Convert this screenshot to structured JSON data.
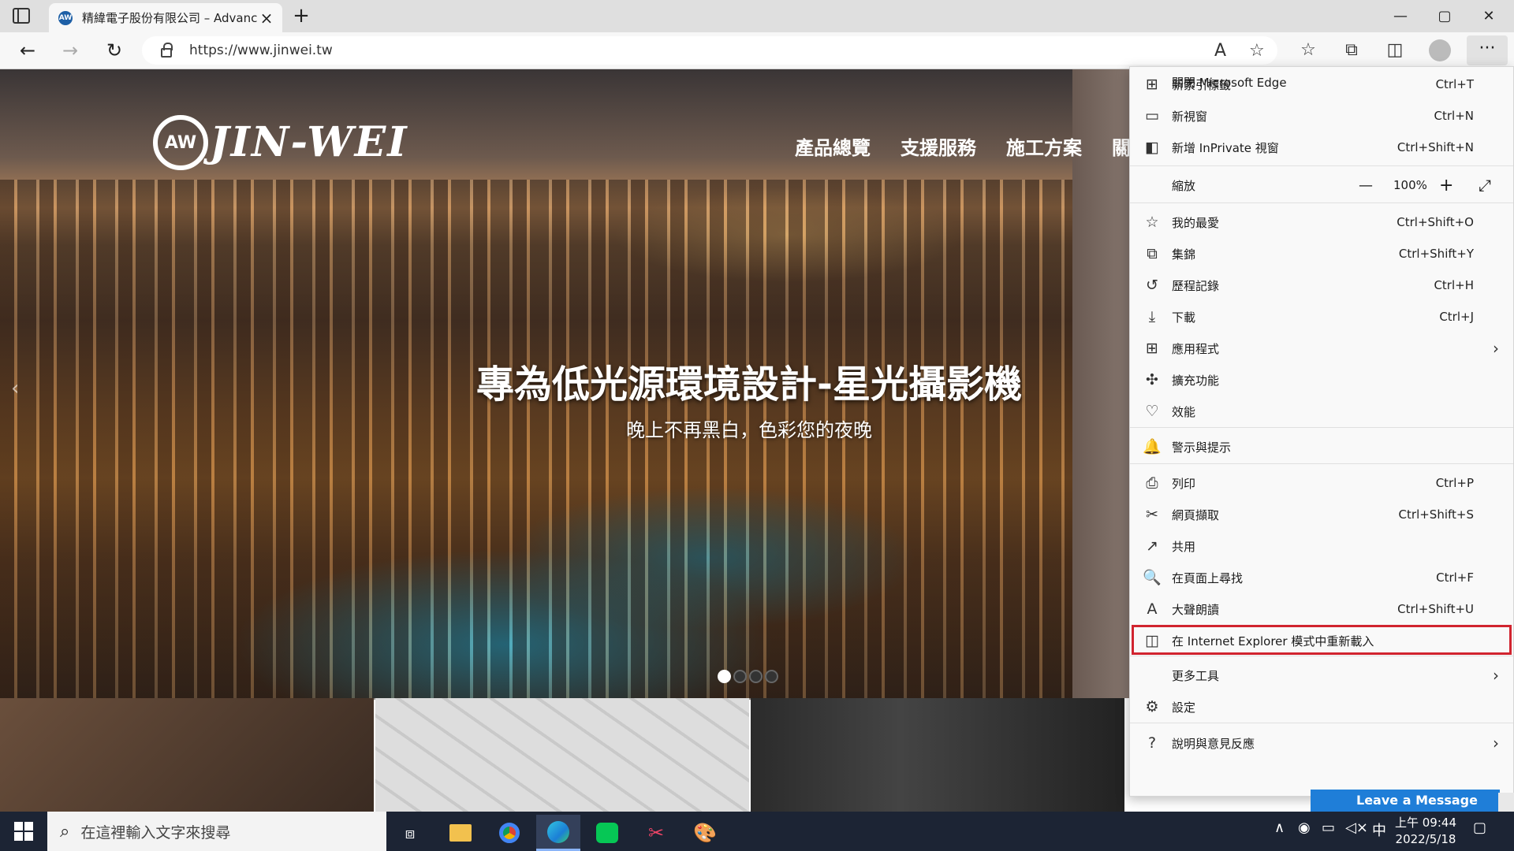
{
  "browser": {
    "tab_title": "精緯電子股份有限公司 – Advanc",
    "tab_favicon_text": "AW",
    "url": "https://www.jinwei.tw",
    "window_controls": {
      "minimize": "—",
      "maximize": "▢",
      "close": "✕"
    },
    "more_label": "···"
  },
  "site": {
    "logo_ring": "AW",
    "logo_text": "JIN-WEI",
    "nav": [
      "產品總覽",
      "支援服務",
      "施工方案",
      "關"
    ],
    "hero_title": "專為低光源環境設計-星光攝影機",
    "hero_subtitle": "晚上不再黑白，色彩您的夜晚",
    "carousel_total": 4,
    "carousel_active_index": 0
  },
  "menu": {
    "items": [
      {
        "icon": "new-tab-icon",
        "glyph": "⊞",
        "label": "新索引標籤",
        "shortcut": "Ctrl+T"
      },
      {
        "icon": "new-window-icon",
        "glyph": "▭",
        "label": "新視窗",
        "shortcut": "Ctrl+N"
      },
      {
        "icon": "inprivate-icon",
        "glyph": "◧",
        "label": "新增 InPrivate 視窗",
        "shortcut": "Ctrl+Shift+N"
      },
      {
        "icon": "favorites-icon",
        "glyph": "☆",
        "label": "我的最愛",
        "shortcut": "Ctrl+Shift+O"
      },
      {
        "icon": "collections-icon",
        "glyph": "⧉",
        "label": "集錦",
        "shortcut": "Ctrl+Shift+Y"
      },
      {
        "icon": "history-icon",
        "glyph": "↺",
        "label": "歷程記錄",
        "shortcut": "Ctrl+H"
      },
      {
        "icon": "download-icon",
        "glyph": "⤓",
        "label": "下載",
        "shortcut": "Ctrl+J"
      },
      {
        "icon": "apps-icon",
        "glyph": "⊞",
        "label": "應用程式",
        "shortcut": ""
      },
      {
        "icon": "extensions-icon",
        "glyph": "✣",
        "label": "擴充功能",
        "shortcut": ""
      },
      {
        "icon": "performance-icon",
        "glyph": "♡",
        "label": "效能",
        "shortcut": ""
      },
      {
        "icon": "bell-icon",
        "glyph": "🔔",
        "label": "警示與提示",
        "shortcut": ""
      },
      {
        "icon": "print-icon",
        "glyph": "⎙",
        "label": "列印",
        "shortcut": "Ctrl+P"
      },
      {
        "icon": "web-capture-icon",
        "glyph": "✂",
        "label": "網頁擷取",
        "shortcut": "Ctrl+Shift+S"
      },
      {
        "icon": "share-icon",
        "glyph": "↗",
        "label": "共用",
        "shortcut": ""
      },
      {
        "icon": "find-icon",
        "glyph": "🔍",
        "label": "在頁面上尋找",
        "shortcut": "Ctrl+F"
      },
      {
        "icon": "read-aloud-icon",
        "glyph": "A",
        "label": "大聲朗讀",
        "shortcut": "Ctrl+Shift+U"
      },
      {
        "icon": "ie-mode-icon",
        "glyph": "◫",
        "label": "在 Internet Explorer 模式中重新載入",
        "shortcut": ""
      },
      {
        "icon": "more-tools-icon",
        "glyph": "",
        "label": "更多工具",
        "shortcut": ""
      },
      {
        "icon": "settings-icon",
        "glyph": "⚙",
        "label": "設定",
        "shortcut": ""
      },
      {
        "icon": "help-icon",
        "glyph": "?",
        "label": "說明與意見反應",
        "shortcut": ""
      },
      {
        "icon": "",
        "glyph": "",
        "label": "關閉 Microsoft Edge",
        "shortcut": ""
      }
    ],
    "zoom": {
      "label": "縮放",
      "value": "100%",
      "minus": "—",
      "plus": "+",
      "fullscreen": "⤢"
    },
    "highlighted_item": "在 Internet Explorer 模式中重新載入",
    "highlight_color": "#d1242f"
  },
  "chat_widget": {
    "label": "Leave a Message"
  },
  "taskbar": {
    "search_placeholder": "在這裡輸入文字來搜尋",
    "clock_time": "上午 09:44",
    "clock_date": "2022/5/18",
    "ime": "中"
  }
}
